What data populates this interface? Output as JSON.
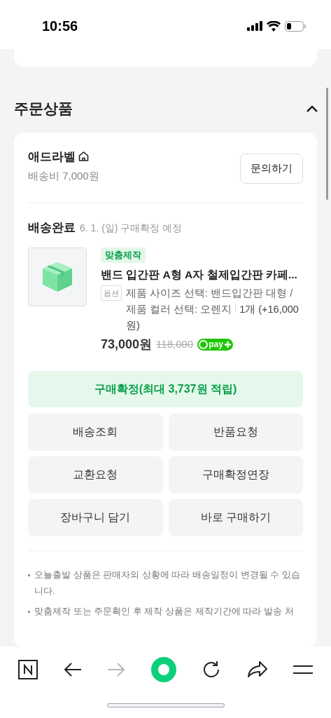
{
  "status_bar": {
    "time": "10:56"
  },
  "section": {
    "title": "주문상품",
    "expanded": true
  },
  "seller": {
    "name": "애드라벨",
    "shipping_fee": "배송비 7,000원",
    "inquiry_button": "문의하기"
  },
  "delivery": {
    "status": "배송완료",
    "note": "6. 1. (일) 구매확정 예정"
  },
  "product": {
    "tag": "맞춤제작",
    "name": "밴드 입간판 A형 A자 철제입간판 카페...",
    "option_label": "옵션",
    "option": "제품 사이즈 선택: 밴드입간판 대형 / 제품 컬러 선택: 오렌지",
    "quantity": "1개 (+16,000원)",
    "price": "73,000원",
    "original_price": "118,000",
    "pay_badge": "pay"
  },
  "confirm_button": "구매확정(최대 3,737원 적립)",
  "actions": [
    "배송조회",
    "반품요청",
    "교환요청",
    "구매확정연장",
    "장바구니 담기",
    "바로 구매하기"
  ],
  "notices": [
    "오늘출발 상품은 판매자의 상황에 따라 배송일정이 변경될 수 있습니다.",
    "맞춤제작 또는 주문확인 후 제작 상품은 제작기간에 따라 발송 처"
  ],
  "toolbar": {
    "forward_disabled": true
  }
}
